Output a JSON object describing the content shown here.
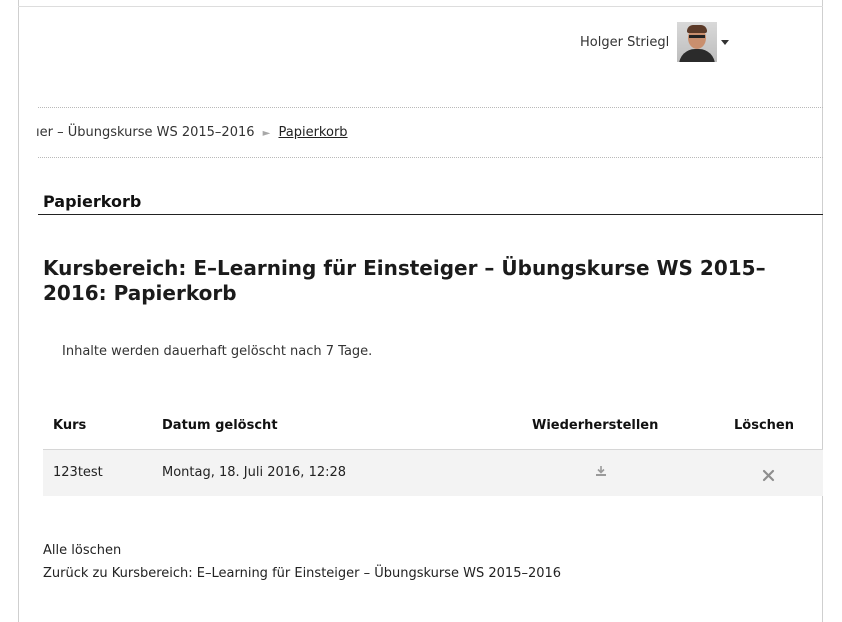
{
  "user": {
    "name": "Holger Striegl"
  },
  "breadcrumb": {
    "partial": "ıer – Übungskurse WS 2015–2016",
    "separator": "►",
    "current": "Papierkorb"
  },
  "block": {
    "title": "Papierkorb"
  },
  "page": {
    "title": "Kursbereich: E–Learning für Einsteiger – Übungskurse WS 2015–2016: Papierkorb",
    "info": "Inhalte werden dauerhaft gelöscht nach 7 Tage."
  },
  "table": {
    "headers": {
      "course": "Kurs",
      "date": "Datum gelöscht",
      "restore": "Wiederherstellen",
      "delete": "Löschen"
    },
    "rows": [
      {
        "course": "123test",
        "date": "Montag, 18. Juli 2016, 12:28",
        "restore_icon": "restore-icon",
        "delete_icon": "delete-icon"
      }
    ]
  },
  "links": {
    "delete_all": "Alle löschen",
    "back": "Zurück zu Kursbereich: E–Learning für Einsteiger – Übungskurse WS 2015–2016"
  },
  "colors": {
    "text": "#222222",
    "rule": "#d6d6d6",
    "row_bg": "#f3f3f3"
  }
}
